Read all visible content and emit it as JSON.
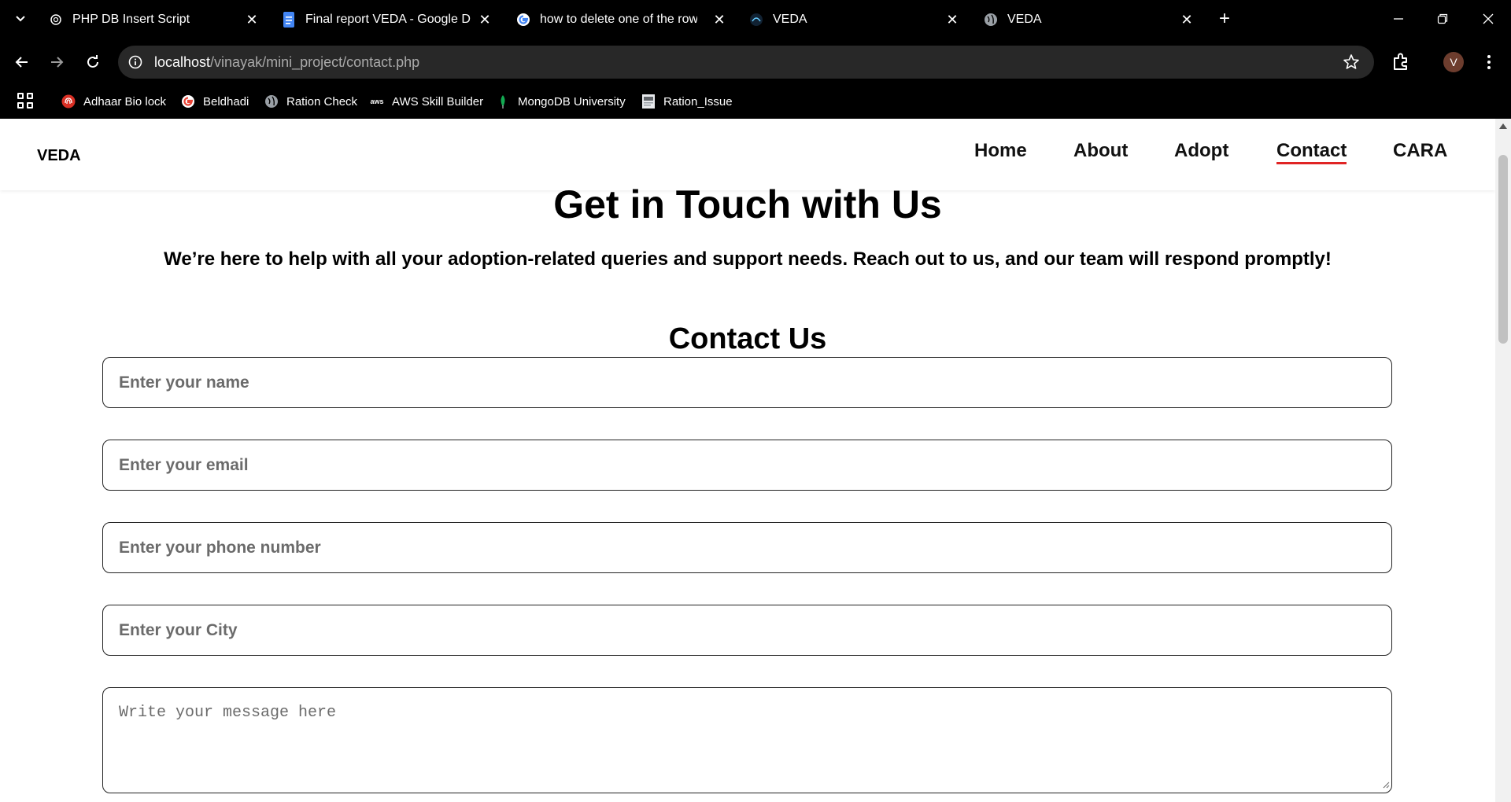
{
  "tabs": [
    {
      "title": "PHP DB Insert Script",
      "icon": "chatgpt-icon"
    },
    {
      "title": "Final report VEDA - Google Doc",
      "icon": "google-docs-icon"
    },
    {
      "title": "how to delete one of the rows in",
      "icon": "google-icon"
    },
    {
      "title": "VEDA",
      "icon": "veda-icon"
    },
    {
      "title": "VEDA",
      "icon": "globe-icon"
    }
  ],
  "address": {
    "host": "localhost",
    "path": "/vinayak/mini_project/contact.php"
  },
  "profile": {
    "initial": "V"
  },
  "bookmarks": [
    {
      "label": "Adhaar Bio lock",
      "icon": "fingerprint-icon"
    },
    {
      "label": "Beldhadi",
      "icon": "google-icon"
    },
    {
      "label": "Ration Check",
      "icon": "globe-icon"
    },
    {
      "label": "AWS Skill Builder",
      "icon": "aws-icon"
    },
    {
      "label": "MongoDB University",
      "icon": "mongodb-icon"
    },
    {
      "label": "Ration_Issue",
      "icon": "document-icon"
    }
  ],
  "site": {
    "brand": "VEDA",
    "nav": [
      "Home",
      "About",
      "Adopt",
      "Contact",
      "CARA"
    ],
    "active_nav": "Contact"
  },
  "hero": {
    "title": "Get in Touch with Us",
    "subtitle": "We’re here to help with all your adoption-related queries and support needs. Reach out to us, and our team will respond promptly!"
  },
  "form": {
    "title": "Contact Us",
    "name_placeholder": "Enter your name",
    "email_placeholder": "Enter your email",
    "phone_placeholder": "Enter your phone number",
    "city_placeholder": "Enter your City",
    "message_placeholder": "Write your message here"
  },
  "colors": {
    "active_underline": "#e02424",
    "omnibox_bg": "#282828"
  }
}
